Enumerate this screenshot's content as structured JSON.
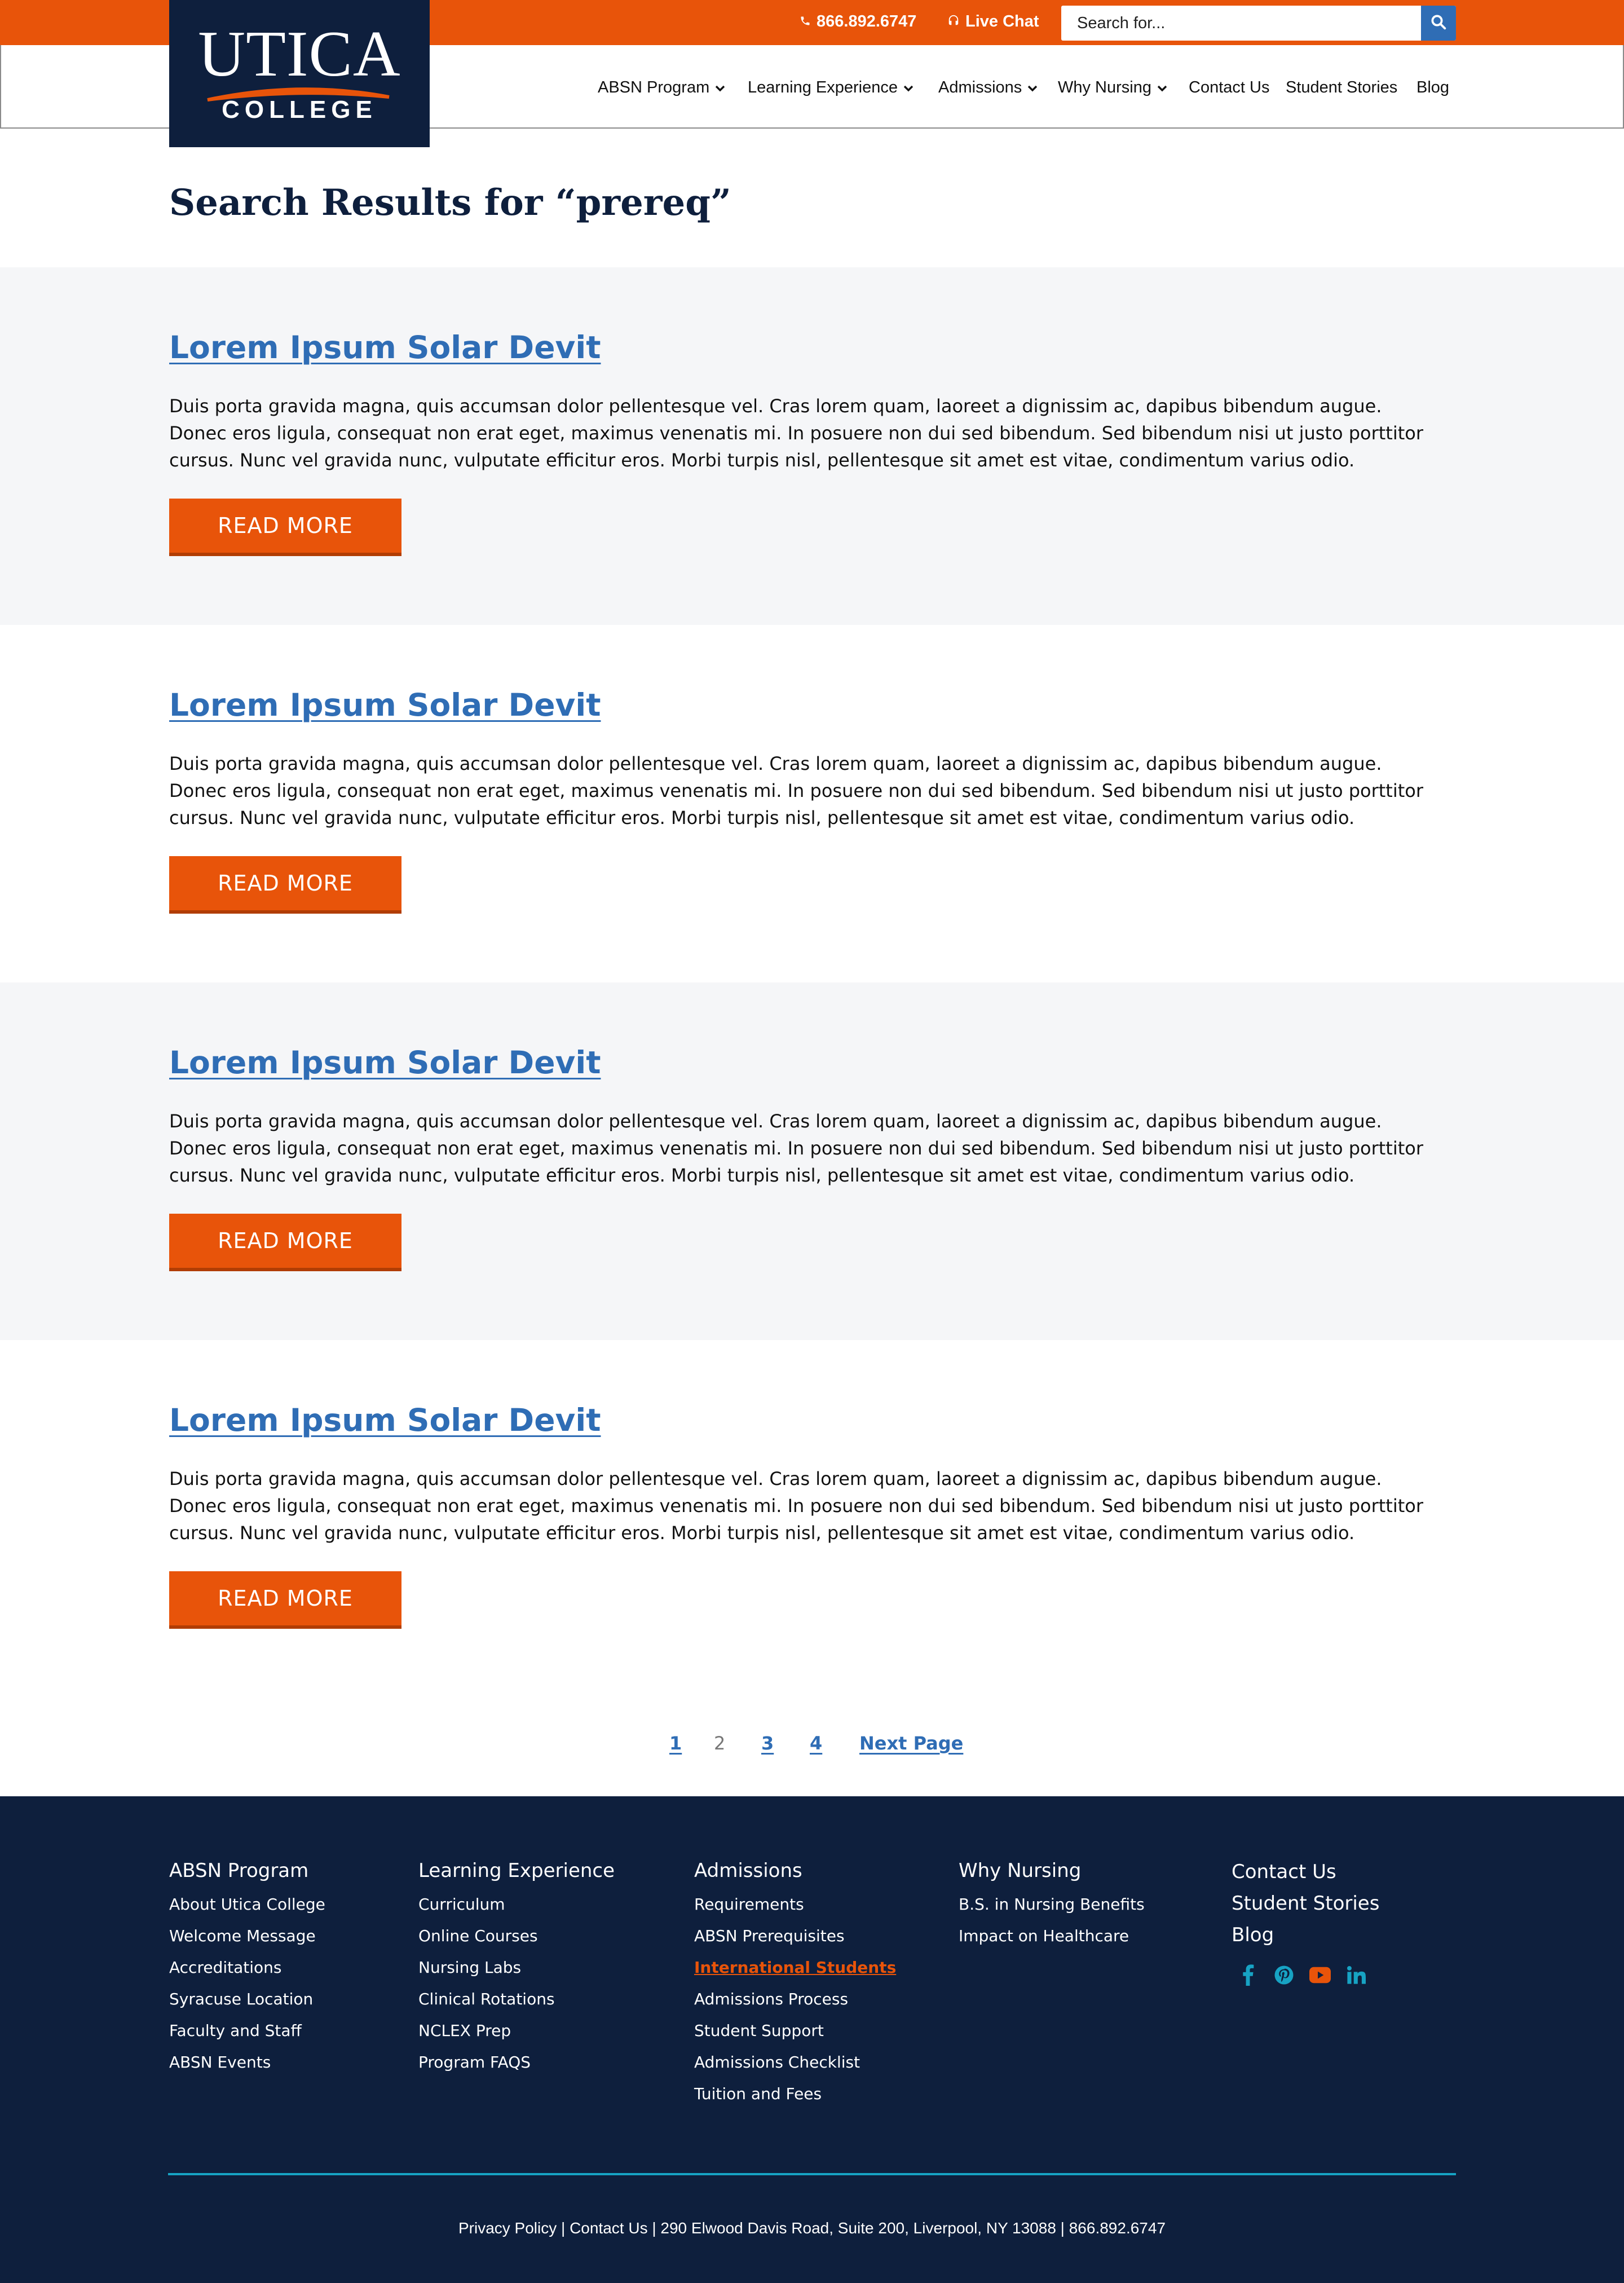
{
  "topbar": {
    "phone": "866.892.6747",
    "live_chat": "Live Chat",
    "search_placeholder": "Search for..."
  },
  "logo": {
    "line1": "UTICA",
    "line2": "COLLEGE"
  },
  "nav": {
    "items": [
      {
        "label": "ABSN Program",
        "dropdown": true
      },
      {
        "label": "Learning Experience",
        "dropdown": true
      },
      {
        "label": "Admissions",
        "dropdown": true
      },
      {
        "label": "Why Nursing",
        "dropdown": true
      },
      {
        "label": "Contact Us",
        "dropdown": false
      },
      {
        "label": "Student Stories",
        "dropdown": false
      },
      {
        "label": "Blog",
        "dropdown": false
      }
    ]
  },
  "page_title": "Search Results for “prereq”",
  "results": [
    {
      "title": "Lorem Ipsum Solar Devit",
      "body": "Duis porta gravida magna, quis accumsan dolor pellentesque vel. Cras lorem quam, laoreet a dignissim ac, dapibus bibendum augue. Donec eros ligula, consequat non erat eget, maximus venenatis mi. In posuere non dui sed bibendum. Sed bibendum nisi ut justo porttitor cursus. Nunc vel gravida nunc, vulputate efficitur eros. Morbi turpis nisl, pellentesque sit amet est vitae, condimentum varius odio.",
      "button": "READ MORE"
    },
    {
      "title": "Lorem Ipsum Solar Devit",
      "body": "Duis porta gravida magna, quis accumsan dolor pellentesque vel. Cras lorem quam, laoreet a dignissim ac, dapibus bibendum augue. Donec eros ligula, consequat non erat eget, maximus venenatis mi. In posuere non dui sed bibendum. Sed bibendum nisi ut justo porttitor cursus. Nunc vel gravida nunc, vulputate efficitur eros. Morbi turpis nisl, pellentesque sit amet est vitae, condimentum varius odio.",
      "button": "READ MORE"
    },
    {
      "title": "Lorem Ipsum Solar Devit",
      "body": "Duis porta gravida magna, quis accumsan dolor pellentesque vel. Cras lorem quam, laoreet a dignissim ac, dapibus bibendum augue. Donec eros ligula, consequat non erat eget, maximus venenatis mi. In posuere non dui sed bibendum. Sed bibendum nisi ut justo porttitor cursus. Nunc vel gravida nunc, vulputate efficitur eros. Morbi turpis nisl, pellentesque sit amet est vitae, condimentum varius odio.",
      "button": "READ MORE"
    },
    {
      "title": "Lorem Ipsum Solar Devit",
      "body": "Duis porta gravida magna, quis accumsan dolor pellentesque vel. Cras lorem quam, laoreet a dignissim ac, dapibus bibendum augue. Donec eros ligula, consequat non erat eget, maximus venenatis mi. In posuere non dui sed bibendum. Sed bibendum nisi ut justo porttitor cursus. Nunc vel gravida nunc, vulputate efficitur eros. Morbi turpis nisl, pellentesque sit amet est vitae, condimentum varius odio.",
      "button": "READ MORE"
    }
  ],
  "pagination": {
    "pages": [
      "1",
      "2",
      "3",
      "4"
    ],
    "current": "2",
    "next": "Next Page"
  },
  "footer": {
    "columns": [
      {
        "heading": "ABSN Program",
        "links": [
          "About Utica College",
          "Welcome Message",
          "Accreditations",
          "Syracuse Location",
          "Faculty and Staff",
          "ABSN Events"
        ]
      },
      {
        "heading": "Learning Experience",
        "links": [
          "Curriculum",
          "Online Courses",
          "Nursing Labs",
          "Clinical Rotations",
          "NCLEX Prep",
          "Program FAQS"
        ]
      },
      {
        "heading": "Admissions",
        "links": [
          "Requirements",
          "ABSN Prerequisites",
          "International Students",
          "Admissions Process",
          "Student Support",
          "Admissions Checklist",
          "Tuition and Fees"
        ],
        "active": "International Students"
      },
      {
        "heading": "Why Nursing",
        "links": [
          "B.S. in Nursing Benefits",
          "Impact on Healthcare"
        ]
      }
    ],
    "quick_links": [
      "Contact Us",
      "Student Stories",
      "Blog"
    ],
    "social": [
      "facebook-icon",
      "pinterest-icon",
      "youtube-icon",
      "linkedin-icon"
    ],
    "bottom_text": "Privacy Policy | Contact Us | 290 Elwood Davis Road, Suite 200, Liverpool, NY 13088 | 866.892.6747"
  },
  "colors": {
    "brand_orange": "#e8540a",
    "navy": "#0e1f3d",
    "link_blue": "#2f6db5",
    "accent_teal": "#17a3c4",
    "result_gray_bg": "#f5f6f8"
  }
}
